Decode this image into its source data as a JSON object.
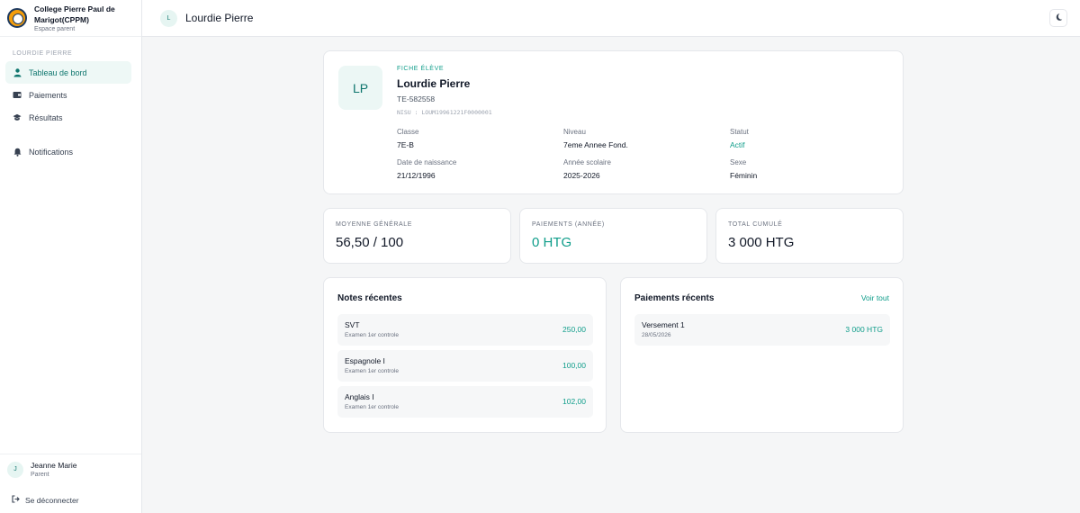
{
  "brand": {
    "name_line1": "College Pierre Paul de",
    "name_line2": "Marigot(CPPM)",
    "subtitle": "Espace parent"
  },
  "sidebar": {
    "section_title": "LOURDIE PIERRE",
    "items": [
      {
        "label": "Tableau de bord",
        "icon": "student-icon",
        "active": true
      },
      {
        "label": "Paiements",
        "icon": "wallet-icon",
        "active": false
      },
      {
        "label": "Résultats",
        "icon": "graduation-cap-icon",
        "active": false
      },
      {
        "label": "Notifications",
        "icon": "bell-icon",
        "active": false
      }
    ],
    "user": {
      "initial": "J",
      "name": "Jeanne Marie",
      "role": "Parent"
    },
    "logout_label": "Se déconnecter"
  },
  "topbar": {
    "avatar_initial": "L",
    "title": "Lourdie Pierre",
    "theme_icon": "moon-icon"
  },
  "profile": {
    "initials": "LP",
    "label": "FICHE ÉLÈVE",
    "name": "Lourdie Pierre",
    "id": "TE-582558",
    "nisu": "NISU : LOUM19961221F0000001",
    "fields": {
      "classe": {
        "label": "Classe",
        "value": "7E-B"
      },
      "niveau": {
        "label": "Niveau",
        "value": "7eme Annee Fond."
      },
      "statut": {
        "label": "Statut",
        "value": "Actif"
      },
      "naissance": {
        "label": "Date de naissance",
        "value": "21/12/1996"
      },
      "annee": {
        "label": "Année scolaire",
        "value": "2025-2026"
      },
      "sexe": {
        "label": "Sexe",
        "value": "Féminin"
      }
    }
  },
  "stats": {
    "moyenne": {
      "label": "MOYENNE GÉNÉRALE",
      "value": "56,50 / 100"
    },
    "paiements": {
      "label": "PAIEMENTS (ANNÉE)",
      "value": "0 HTG"
    },
    "total": {
      "label": "TOTAL CUMULÉ",
      "value": "3 000 HTG"
    }
  },
  "notes": {
    "title": "Notes récentes",
    "items": [
      {
        "subject": "SVT",
        "exam": "Examen 1er controle",
        "score": "250,00"
      },
      {
        "subject": "Espagnole I",
        "exam": "Examen 1er controle",
        "score": "100,00"
      },
      {
        "subject": "Anglais I",
        "exam": "Examen 1er controle",
        "score": "102,00"
      }
    ]
  },
  "payments": {
    "title": "Paiements récents",
    "link": "Voir tout",
    "items": [
      {
        "label": "Versement 1",
        "date": "28/05/2026",
        "amount": "3 000 HTG"
      }
    ]
  },
  "colors": {
    "accent": "#0f9d8a",
    "accent_dark": "#0f766e",
    "active_bg": "#eef8f6",
    "background": "#f5f6f7"
  }
}
